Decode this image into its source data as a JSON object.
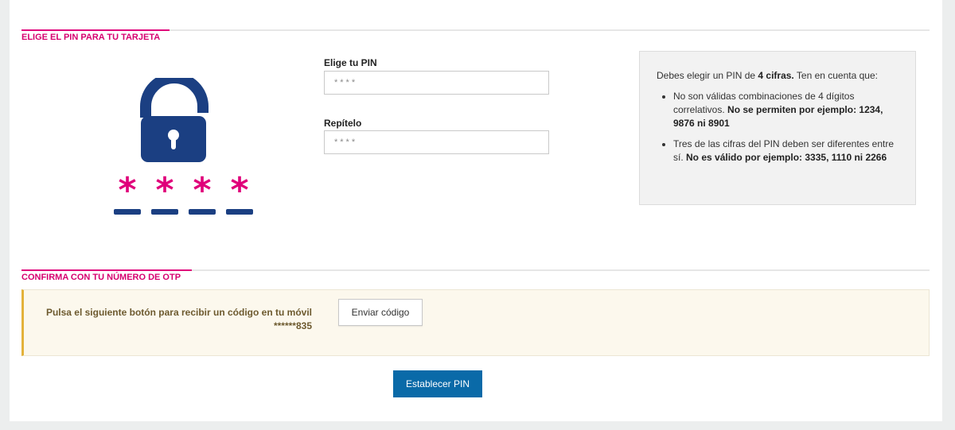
{
  "colors": {
    "accent": "#e0007a",
    "lock": "#1b3f82",
    "primary": "#0a6aa8",
    "otp_border": "#e3b23a"
  },
  "pin_section": {
    "title": "ELIGE EL PIN PARA TU TARJETA",
    "illustration": "padlock-icon",
    "pin_label": "Elige tu PIN",
    "pin_placeholder": "****",
    "repeat_label": "Repítelo",
    "repeat_placeholder": "****",
    "info": {
      "intro_pre": "Debes elegir un PIN de ",
      "intro_bold": "4 cifras.",
      "intro_post": " Ten en cuenta que:",
      "rules": [
        {
          "text": "No son válidas combinaciones de 4 dígitos correlativos. ",
          "bold": "No se permiten por ejemplo: 1234, 9876 ni 8901"
        },
        {
          "text": "Tres de las cifras del PIN deben ser diferentes entre sí. ",
          "bold": "No es válido por ejemplo: 3335, 1110 ni 2266"
        }
      ]
    }
  },
  "otp_section": {
    "title": "CONFIRMA CON TU NÚMERO DE OTP",
    "message": "Pulsa el siguiente botón para recibir un código en tu móvil",
    "phone": "******835",
    "send_button": "Enviar código"
  },
  "submit_button": "Establecer PIN"
}
